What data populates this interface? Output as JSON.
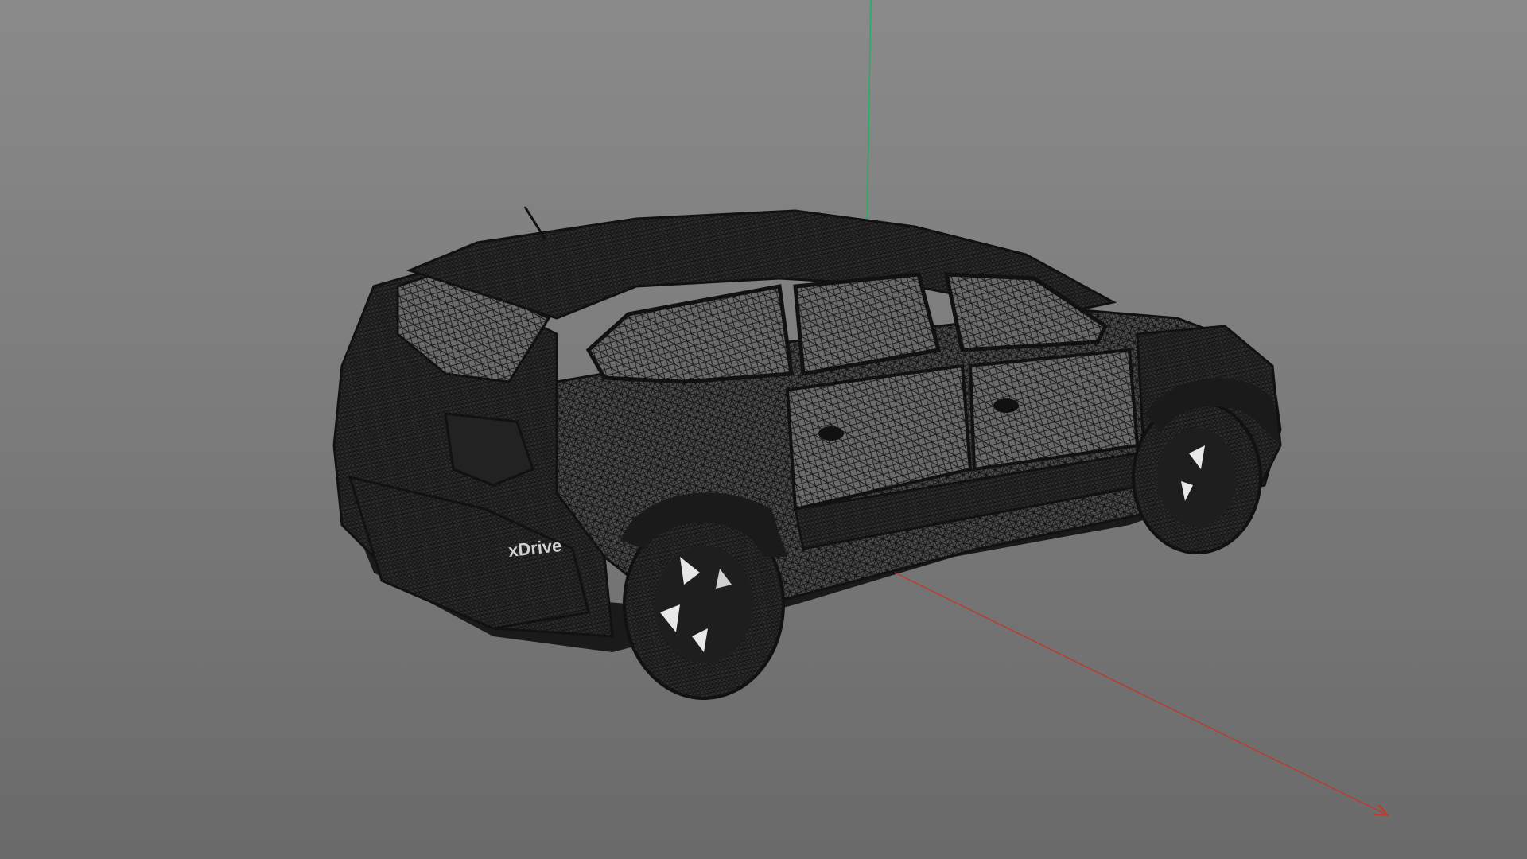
{
  "viewport": {
    "background_top": "#8a8a8a",
    "background_bottom": "#6a6a6a"
  },
  "axes": {
    "x_color": "#c0392b",
    "y_color": "#27ae60"
  },
  "model": {
    "render_mode": "wireframe",
    "mesh_color": "#1c1c1c",
    "fill_color": "#3a3a3a",
    "badge_text": "xDrive"
  }
}
